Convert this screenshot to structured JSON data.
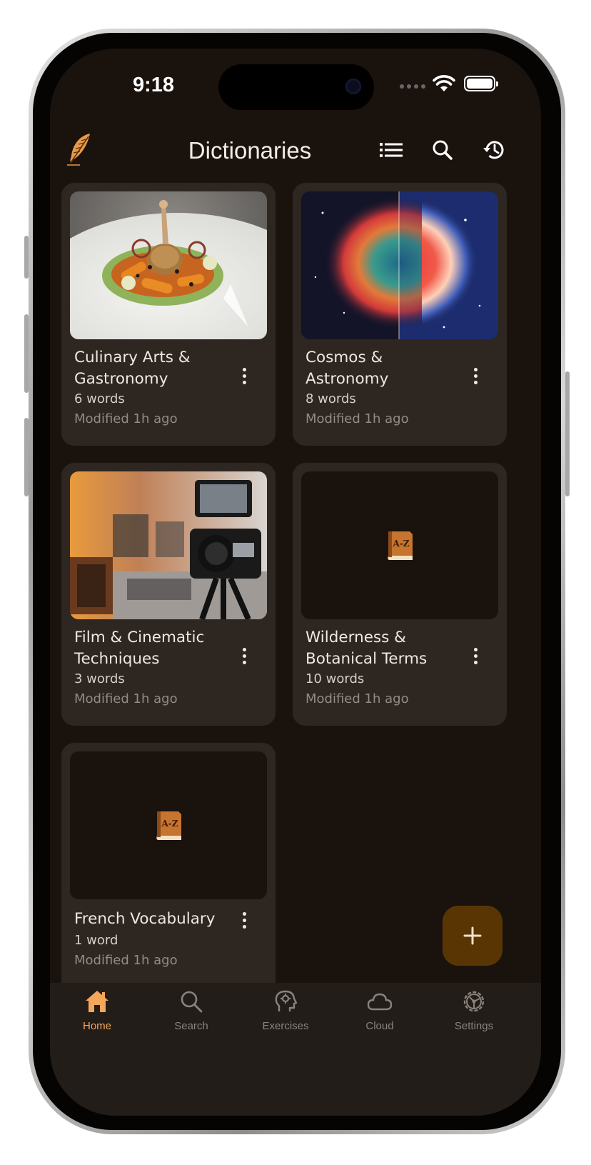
{
  "status_bar": {
    "time": "9:18"
  },
  "app_bar": {
    "title": "Dictionaries",
    "icons": [
      "feather-icon",
      "list-view-icon",
      "search-icon",
      "history-icon"
    ]
  },
  "dictionaries": [
    {
      "title": "Culinary Arts & Gastronomy",
      "count": "6 words",
      "modified": "Modified 1h ago",
      "thumbnail": "plated-dish-photo"
    },
    {
      "title": "Cosmos & Astronomy",
      "count": "8 words",
      "modified": "Modified 1h ago",
      "thumbnail": "nebula-photo"
    },
    {
      "title": "Film & Cinematic Techniques",
      "count": "3 words",
      "modified": "Modified 1h ago",
      "thumbnail": "camera-rig-photo"
    },
    {
      "title": "Wilderness & Botanical Terms",
      "count": "10 words",
      "modified": "Modified 1h ago",
      "thumbnail": "a-z-book-icon"
    },
    {
      "title": "French Vocabulary",
      "count": "1 word",
      "modified": "Modified 1h ago",
      "thumbnail": "a-z-book-icon"
    }
  ],
  "fab": {
    "icon": "plus-icon"
  },
  "bottom_nav": {
    "items": [
      {
        "label": "Home",
        "icon": "home-icon",
        "active": true
      },
      {
        "label": "Search",
        "icon": "search-icon",
        "active": false
      },
      {
        "label": "Exercises",
        "icon": "brain-gear-icon",
        "active": false
      },
      {
        "label": "Cloud",
        "icon": "cloud-icon",
        "active": false
      },
      {
        "label": "Settings",
        "icon": "settings-gear-icon",
        "active": false
      }
    ]
  },
  "colors": {
    "background": "#1a120d",
    "card": "#2e2621",
    "accent": "#f3a75a",
    "fab": "#5a3504",
    "nav_bg": "#231d19"
  }
}
